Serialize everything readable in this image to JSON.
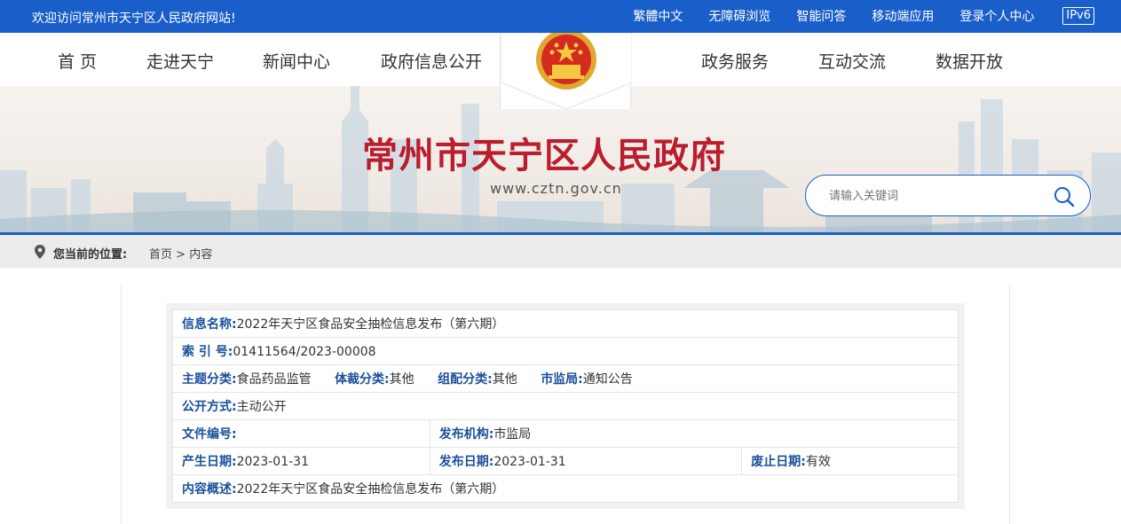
{
  "topbar": {
    "welcome": "欢迎访问常州市天宁区人民政府网站!",
    "links": [
      "繁體中文",
      "无障碍浏览",
      "智能问答",
      "移动端应用",
      "登录个人中心"
    ],
    "ipv6": "IPv6"
  },
  "nav": {
    "left": [
      "首 页",
      "走进天宁",
      "新闻中心",
      "政府信息公开"
    ],
    "right": [
      "政务服务",
      "互动交流",
      "数据开放"
    ]
  },
  "banner": {
    "title": "常州市天宁区人民政府",
    "url": "www.cztn.gov.cn",
    "search_placeholder": "请输入关键词"
  },
  "breadcrumb": {
    "label": "您当前的位置:",
    "home": "首页",
    "sep": ">",
    "current": "内容"
  },
  "info": {
    "name_k": "信息名称:",
    "name_v": "2022年天宁区食品安全抽检信息发布（第六期）",
    "index_k": "索 引 号:",
    "index_v": "01411564/2023-00008",
    "topic_k": "主题分类:",
    "topic_v": "食品药品监管",
    "genre_k": "体裁分类:",
    "genre_v": "其他",
    "group_k": "组配分类:",
    "group_v": "其他",
    "bureau_k": "市监局:",
    "bureau_v": "通知公告",
    "open_k": "公开方式:",
    "open_v": "主动公开",
    "docno_k": "文件编号:",
    "docno_v": "",
    "issuer_k": "发布机构:",
    "issuer_v": "市监局",
    "created_k": "产生日期:",
    "created_v": "2023-01-31",
    "published_k": "发布日期:",
    "published_v": "2023-01-31",
    "expire_k": "废止日期:",
    "expire_v": "有效",
    "summary_k": "内容概述:",
    "summary_v": "2022年天宁区食品安全抽检信息发布（第六期）"
  },
  "colors": {
    "brand_blue": "#1a5fc9",
    "title_red": "#b91d2e",
    "label_blue": "#1a4f9c"
  }
}
